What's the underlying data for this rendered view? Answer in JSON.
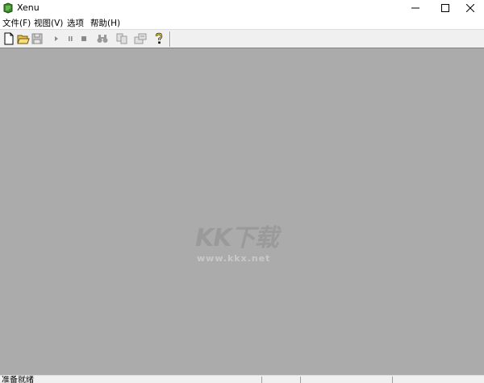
{
  "window": {
    "title": "Xenu"
  },
  "menu": {
    "items": [
      {
        "label": "文件(F)"
      },
      {
        "label": "视图(V)"
      },
      {
        "label": "选项"
      },
      {
        "label": "帮助(H)"
      }
    ]
  },
  "toolbar": {
    "buttons": [
      {
        "icon": "new-document-icon",
        "enabled": true
      },
      {
        "icon": "open-folder-icon",
        "enabled": true
      },
      {
        "icon": "save-icon",
        "enabled": false
      },
      {
        "icon": "play-icon",
        "enabled": false
      },
      {
        "icon": "pause-icon",
        "enabled": false
      },
      {
        "icon": "stop-icon",
        "enabled": false
      },
      {
        "icon": "binoculars-icon",
        "enabled": false
      },
      {
        "icon": "copy-icon",
        "enabled": false
      },
      {
        "icon": "properties-icon",
        "enabled": false
      },
      {
        "icon": "help-icon",
        "enabled": true
      }
    ]
  },
  "watermark": {
    "logo": "KK下载",
    "url": "www.kkx.net"
  },
  "statusbar": {
    "text": "准备就绪"
  },
  "colors": {
    "workspace_bg": "#ababab",
    "toolbar_bg": "#f0f0f0",
    "app_icon_green": "#3a8a2a"
  }
}
